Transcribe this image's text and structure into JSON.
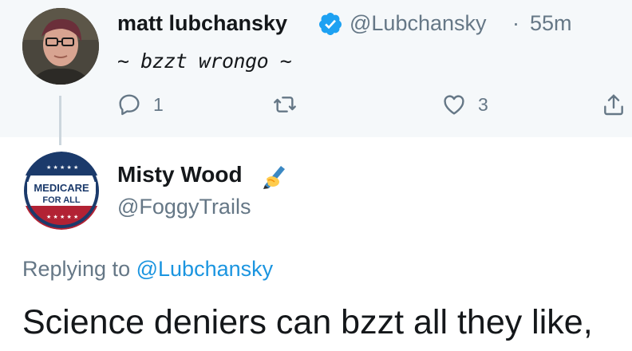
{
  "parent_tweet": {
    "author_name": "matt lubchansky",
    "verified_icon": "verified-badge-icon",
    "handle": "@Lubchansky",
    "separator": "·",
    "time": "55m",
    "text": "~ bzzt wrongo ~",
    "reply_count": "1",
    "retweet_count": "",
    "like_count": "3"
  },
  "reply_tweet": {
    "author_name": "Misty Wood",
    "name_emoji": "writing-hand-icon",
    "handle": "@FoggyTrails",
    "avatar_badge": "MEDICARE FOR ALL",
    "replying_prefix": "Replying to",
    "replying_to": "@Lubchansky",
    "text": "Science deniers can bzzt all they like,"
  },
  "colors": {
    "accent": "#1da1f2",
    "muted": "#657786",
    "text": "#14171a",
    "parent_bg": "#f5f8fa"
  }
}
